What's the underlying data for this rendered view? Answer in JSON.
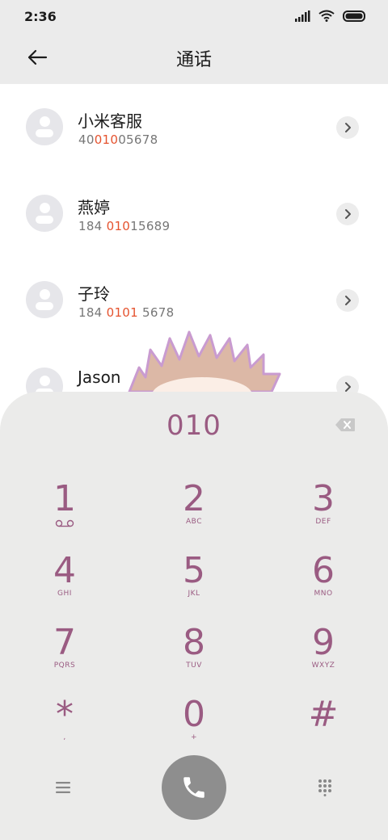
{
  "status_bar": {
    "time": "2:36"
  },
  "header": {
    "title": "通话"
  },
  "contacts": [
    {
      "name": "小米客服",
      "number_pre": "40",
      "number_hl": "010",
      "number_post": "05678"
    },
    {
      "name": "燕婷",
      "number_pre": "184 ",
      "number_hl": "010",
      "number_post": "15689"
    },
    {
      "name": "子玲",
      "number_pre": "184 ",
      "number_hl": "0101",
      "number_post": " 5678"
    },
    {
      "name": "Jason",
      "number_pre": "",
      "number_hl": "",
      "number_post": ""
    }
  ],
  "dialer": {
    "input": "010",
    "keys": [
      {
        "digit": "1",
        "letters": ""
      },
      {
        "digit": "2",
        "letters": "ABC"
      },
      {
        "digit": "3",
        "letters": "DEF"
      },
      {
        "digit": "4",
        "letters": "GHI"
      },
      {
        "digit": "5",
        "letters": "JKL"
      },
      {
        "digit": "6",
        "letters": "MNO"
      },
      {
        "digit": "7",
        "letters": "PQRS"
      },
      {
        "digit": "8",
        "letters": "TUV"
      },
      {
        "digit": "9",
        "letters": "WXYZ"
      },
      {
        "digit": "*",
        "letters": ","
      },
      {
        "digit": "0",
        "letters": "+"
      },
      {
        "digit": "#",
        "letters": ""
      }
    ]
  },
  "colors": {
    "accent": "#9a5b82",
    "highlight": "#e5532f",
    "call_button": "#8e8e8e",
    "panel": "#ebebea"
  },
  "icons": {
    "back": "arrow-left-icon",
    "voicemail": "voicemail-icon",
    "backspace": "backspace-icon",
    "menu": "menu-icon",
    "call": "phone-icon",
    "dialpad": "dialpad-icon"
  }
}
